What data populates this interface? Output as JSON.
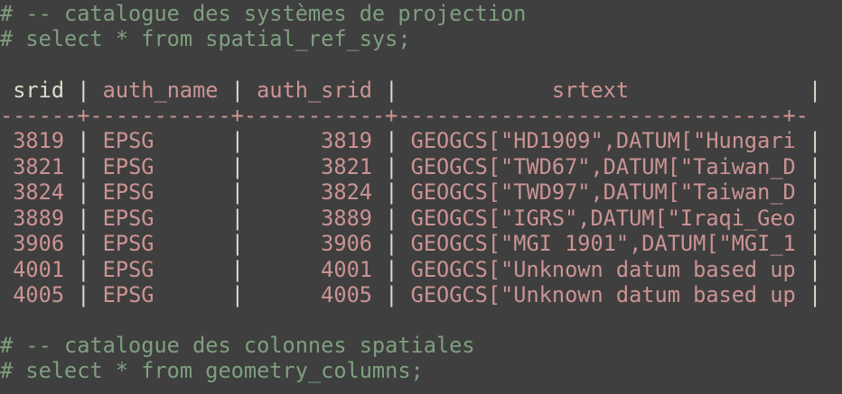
{
  "comments_top": [
    "# -- catalogue des systèmes de projection",
    "# select * from spatial_ref_sys;"
  ],
  "table": {
    "headers": [
      "srid",
      "auth_name",
      "auth_srid",
      "srtext"
    ],
    "rows": [
      [
        "3819",
        "EPSG",
        "3819",
        "GEOGCS[\"HD1909\",DATUM[\"Hungari"
      ],
      [
        "3821",
        "EPSG",
        "3821",
        "GEOGCS[\"TWD67\",DATUM[\"Taiwan_D"
      ],
      [
        "3824",
        "EPSG",
        "3824",
        "GEOGCS[\"TWD97\",DATUM[\"Taiwan_D"
      ],
      [
        "3889",
        "EPSG",
        "3889",
        "GEOGCS[\"IGRS\",DATUM[\"Iraqi_Geo"
      ],
      [
        "3906",
        "EPSG",
        "3906",
        "GEOGCS[\"MGI 1901\",DATUM[\"MGI_1"
      ],
      [
        "4001",
        "EPSG",
        "4001",
        "GEOGCS[\"Unknown datum based up"
      ],
      [
        "4005",
        "EPSG",
        "4005",
        "GEOGCS[\"Unknown datum based up"
      ]
    ]
  },
  "comments_bottom": [
    "# -- catalogue des colonnes spatiales",
    "# select * from geometry_columns;"
  ],
  "colors": {
    "background": "#3f3f3f",
    "comment": "#7f9f7f",
    "value": "#cc9393",
    "text": "#dcdccc"
  }
}
